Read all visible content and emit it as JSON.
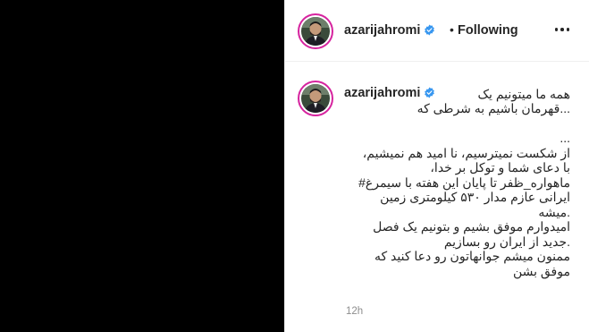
{
  "post": {
    "username": "azarijahromi",
    "separator": "•",
    "follow_status": "Following",
    "verified_icon": "verified-badge-icon",
    "more_icon": "more-options-icon"
  },
  "caption": {
    "username": "azarijahromi",
    "first_line": "همه ما میتونیم یک",
    "lines": [
      "...قهرمان باشیم به شرطی که",
      "",
      "...",
      "از شکست نمیترسیم، نا امید هم نمیشیم،",
      "با دعای شما و توکل بر خدا،",
      "ماهواره_ظفر تا پایان این هفته با سیمرغ#",
      "ایرانی عازم مدار ۵۳۰ کیلومتری زمین",
      ".میشه",
      "امیدوارم موفق بشیم و بتونیم یک فصل",
      ".جدید از ایران رو بسازیم",
      "ممنون میشم جوانهاتون رو دعا کنید که",
      "موفق بشن"
    ],
    "timestamp": "12h"
  },
  "colors": {
    "verified": "#3897f0",
    "story_ring": "#d6249f",
    "text": "#262626",
    "muted": "#8e8e8e"
  }
}
